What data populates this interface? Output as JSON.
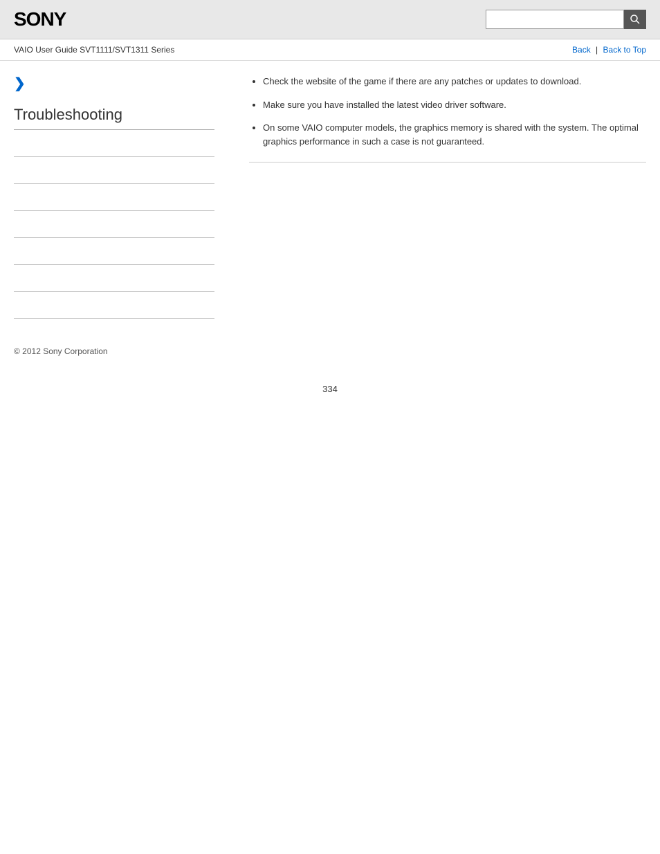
{
  "header": {
    "logo": "SONY",
    "search_placeholder": ""
  },
  "subheader": {
    "guide_title": "VAIO User Guide SVT1111/SVT1311 Series",
    "back_label": "Back",
    "back_to_top_label": "Back to Top"
  },
  "sidebar": {
    "chevron": "❯",
    "section_title": "Troubleshooting",
    "nav_items": [
      {
        "label": ""
      },
      {
        "label": ""
      },
      {
        "label": ""
      },
      {
        "label": ""
      },
      {
        "label": ""
      },
      {
        "label": ""
      },
      {
        "label": ""
      }
    ]
  },
  "content": {
    "bullet1": "Check the website of the game if there are any patches or updates to download.",
    "bullet2": "Make sure you have installed the latest video driver software.",
    "bullet3": "On some VAIO computer models, the graphics memory is shared with the system. The optimal graphics performance in such a case is not guaranteed."
  },
  "footer": {
    "copyright": "© 2012 Sony Corporation"
  },
  "page_number": "334"
}
